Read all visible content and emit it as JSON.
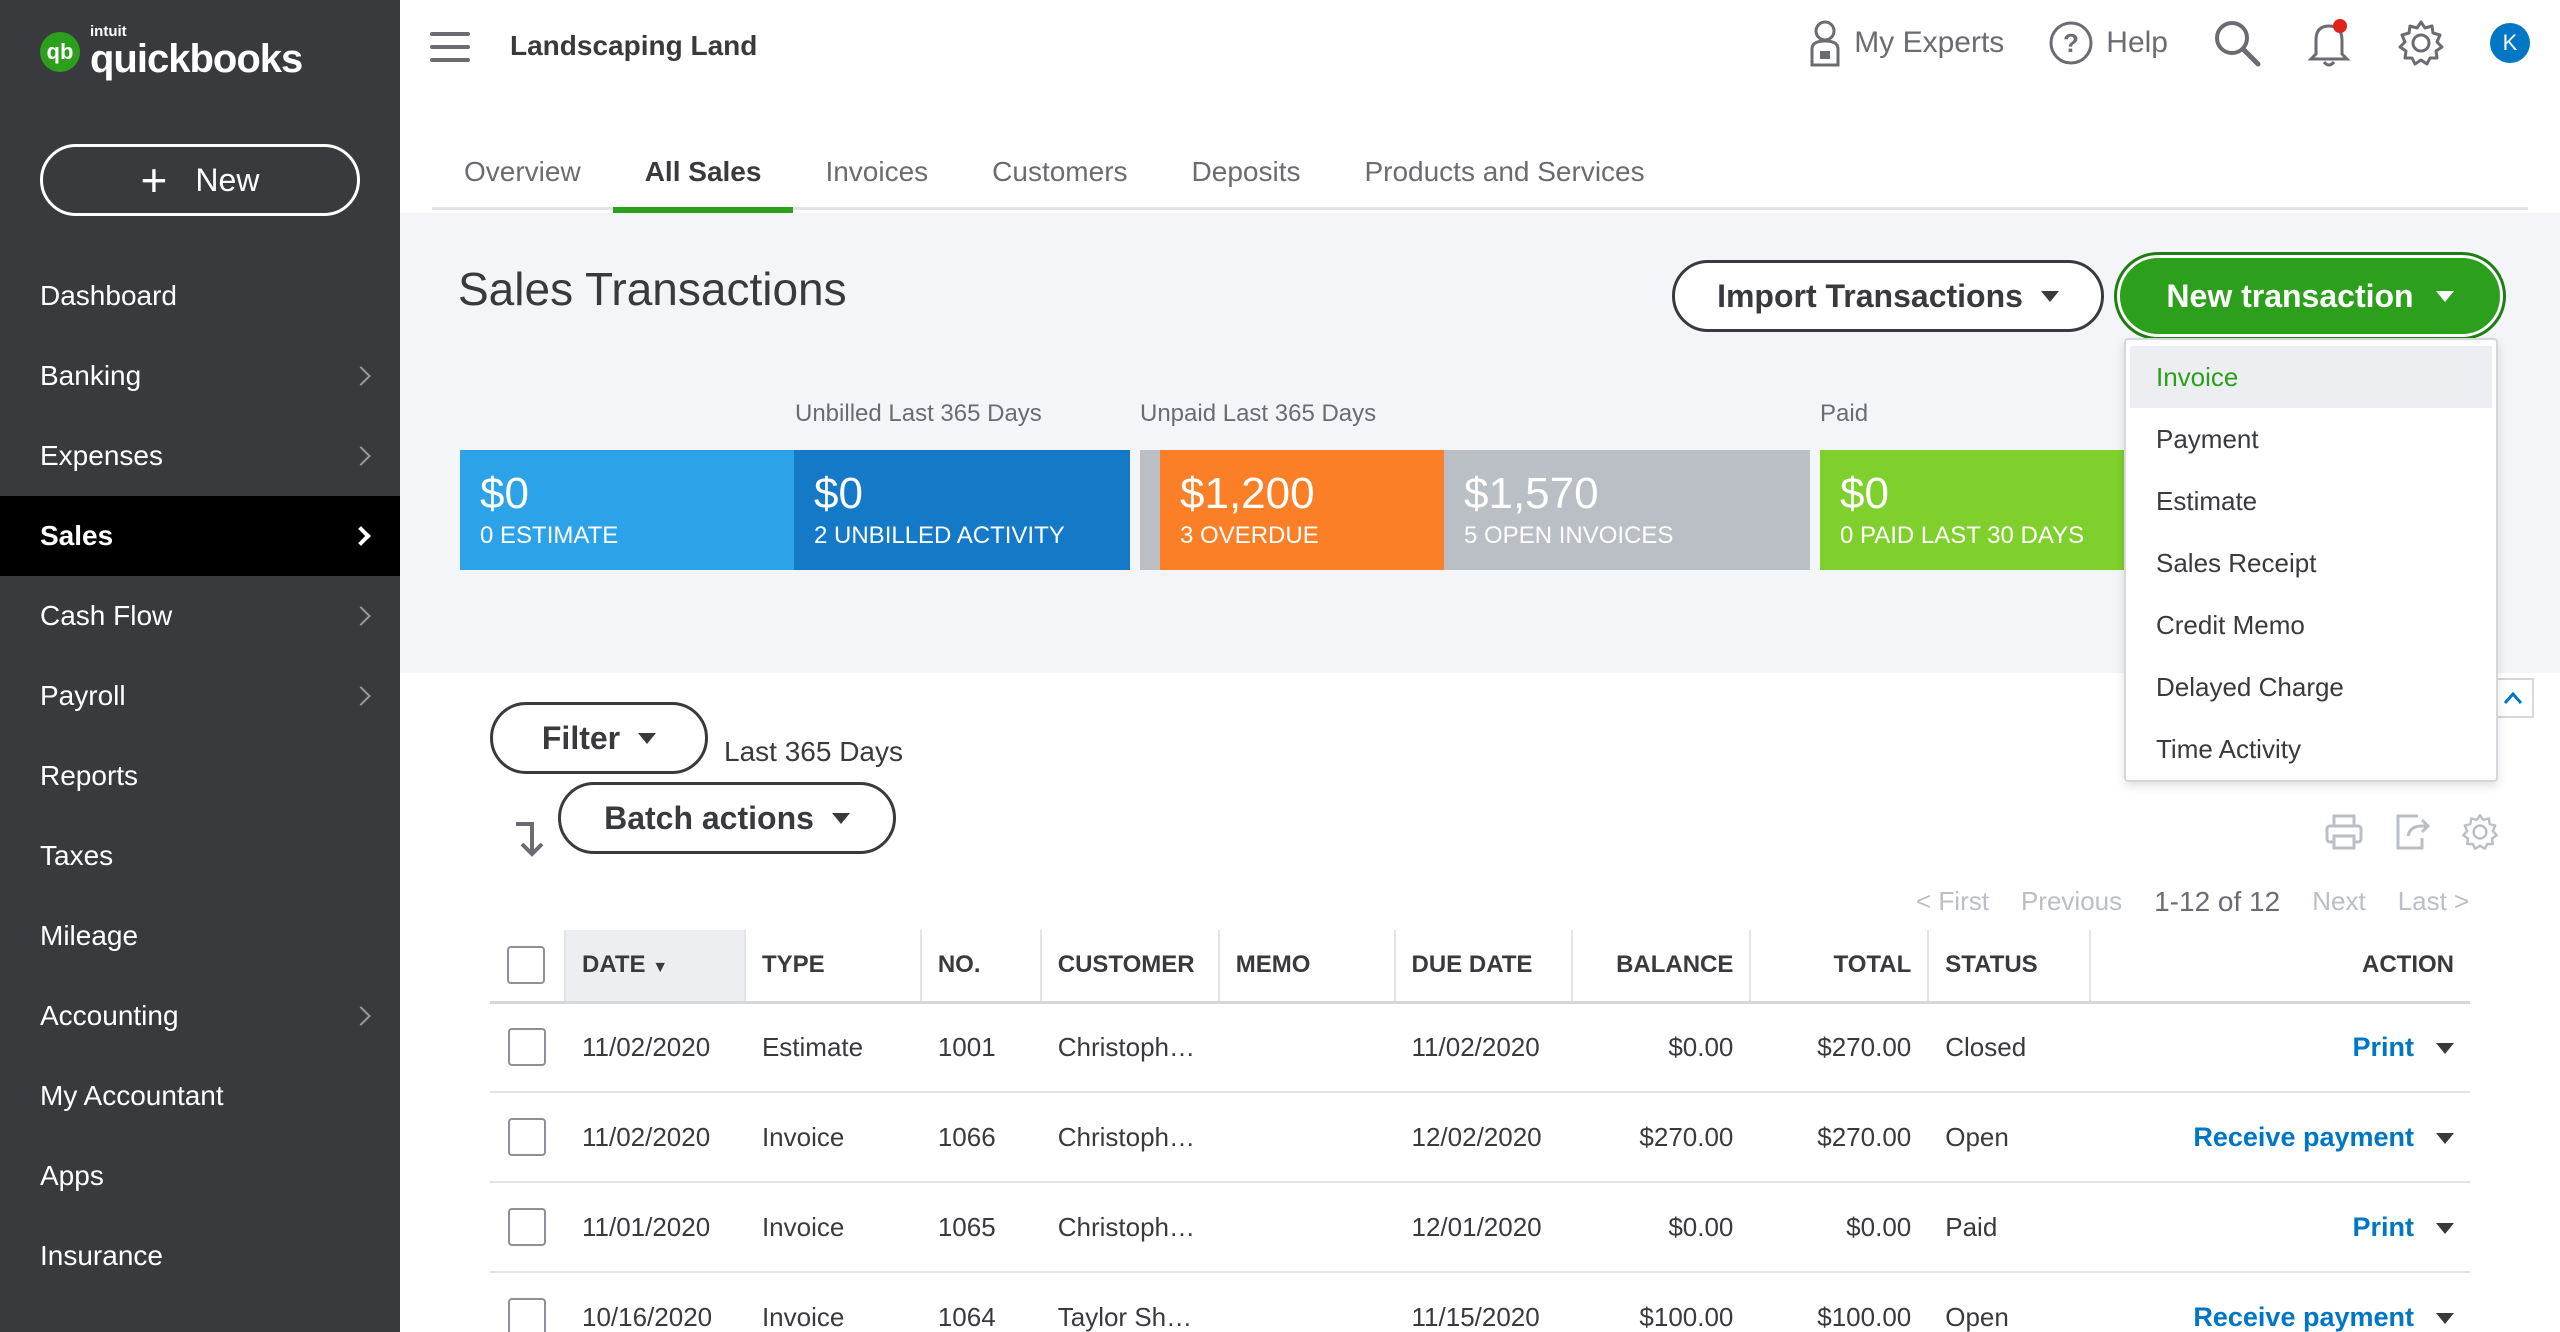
{
  "app": {
    "brand_small": "intuit",
    "brand_name": "quickbooks",
    "logo_mark": "qb"
  },
  "sidebar": {
    "new_label": "New",
    "items": [
      {
        "label": "Dashboard",
        "chevron": false,
        "active": false
      },
      {
        "label": "Banking",
        "chevron": true,
        "active": false
      },
      {
        "label": "Expenses",
        "chevron": true,
        "active": false
      },
      {
        "label": "Sales",
        "chevron": true,
        "active": true
      },
      {
        "label": "Cash Flow",
        "chevron": true,
        "active": false
      },
      {
        "label": "Payroll",
        "chevron": true,
        "active": false
      },
      {
        "label": "Reports",
        "chevron": false,
        "active": false
      },
      {
        "label": "Taxes",
        "chevron": false,
        "active": false
      },
      {
        "label": "Mileage",
        "chevron": false,
        "active": false
      },
      {
        "label": "Accounting",
        "chevron": true,
        "active": false
      },
      {
        "label": "My Accountant",
        "chevron": false,
        "active": false
      },
      {
        "label": "Apps",
        "chevron": false,
        "active": false
      },
      {
        "label": "Insurance",
        "chevron": false,
        "active": false
      }
    ]
  },
  "topbar": {
    "company": "Landscaping Land",
    "my_experts": "My Experts",
    "help": "Help",
    "avatar_initial": "K"
  },
  "tabs": [
    {
      "label": "Overview",
      "active": false
    },
    {
      "label": "All Sales",
      "active": true
    },
    {
      "label": "Invoices",
      "active": false
    },
    {
      "label": "Customers",
      "active": false
    },
    {
      "label": "Deposits",
      "active": false
    },
    {
      "label": "Products and Services",
      "active": false
    }
  ],
  "page": {
    "title": "Sales Transactions",
    "import_label": "Import Transactions",
    "new_transaction_label": "New transaction"
  },
  "money_bar": {
    "labels": {
      "unbilled": "Unbilled Last 365 Days",
      "unpaid": "Unpaid Last 365 Days",
      "paid": "Paid"
    },
    "tiles": [
      {
        "amount": "$0",
        "caption": "0 ESTIMATE",
        "color": "#2ca3e8"
      },
      {
        "amount": "$0",
        "caption": "2 UNBILLED ACTIVITY",
        "color": "#1479c6"
      },
      {
        "amount": "$1,200",
        "caption": "3 OVERDUE",
        "color": "#fb7f27"
      },
      {
        "amount": "$1,570",
        "caption": "5 OPEN INVOICES",
        "color": "#babec5"
      },
      {
        "amount": "$0",
        "caption": "0 PAID LAST 30 DAYS",
        "color": "#7fd02d"
      }
    ]
  },
  "new_transaction_menu": {
    "items": [
      "Invoice",
      "Payment",
      "Estimate",
      "Sales Receipt",
      "Credit Memo",
      "Delayed Charge",
      "Time Activity"
    ],
    "selected": "Invoice"
  },
  "filters": {
    "filter_label": "Filter",
    "date_range": "Last 365 Days",
    "batch_label": "Batch actions"
  },
  "pagination": {
    "first": "< First",
    "previous": "Previous",
    "count": "1-12 of 12",
    "next": "Next",
    "last": "Last >"
  },
  "table": {
    "columns": [
      "DATE",
      "TYPE",
      "NO.",
      "CUSTOMER",
      "MEMO",
      "DUE DATE",
      "BALANCE",
      "TOTAL",
      "STATUS",
      "ACTION"
    ],
    "rows": [
      {
        "date": "11/02/2020",
        "type": "Estimate",
        "no": "1001",
        "customer": "Christoph…",
        "memo": "",
        "due": "11/02/2020",
        "balance": "$0.00",
        "total": "$270.00",
        "status": "Closed",
        "status_green": true,
        "action": "Print"
      },
      {
        "date": "11/02/2020",
        "type": "Invoice",
        "no": "1066",
        "customer": "Christoph…",
        "memo": "",
        "due": "12/02/2020",
        "balance": "$270.00",
        "total": "$270.00",
        "status": "Open",
        "status_green": false,
        "action": "Receive payment"
      },
      {
        "date": "11/01/2020",
        "type": "Invoice",
        "no": "1065",
        "customer": "Christoph…",
        "memo": "",
        "due": "12/01/2020",
        "balance": "$0.00",
        "total": "$0.00",
        "status": "Paid",
        "status_green": true,
        "action": "Print"
      },
      {
        "date": "10/16/2020",
        "type": "Invoice",
        "no": "1064",
        "customer": "Taylor Sh…",
        "memo": "",
        "due": "11/15/2020",
        "balance": "$100.00",
        "total": "$100.00",
        "status": "Open",
        "status_green": false,
        "action": "Receive payment"
      }
    ]
  },
  "icons": {
    "experts": "user-lock-icon",
    "help": "question-circle-icon",
    "search": "search-icon",
    "notifications": "bell-icon",
    "settings": "gear-icon",
    "print": "printer-icon",
    "export": "export-icon",
    "table_settings": "gear-icon"
  }
}
